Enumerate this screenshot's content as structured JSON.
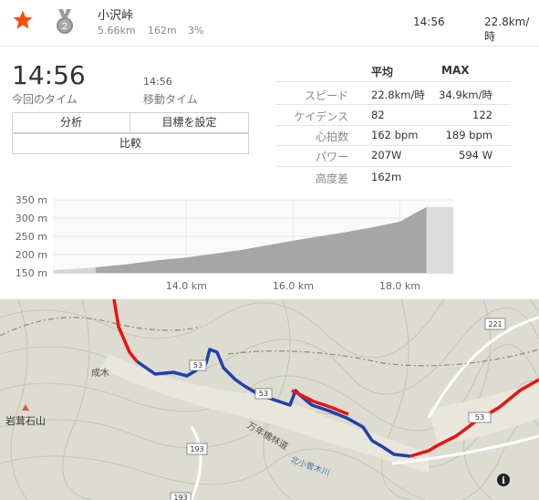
{
  "header": {
    "segment_name": "小沢峠",
    "distance": "5.66km",
    "elevation": "162m",
    "grade": "3%",
    "time": "14:56",
    "speed": "22.8km/時",
    "medal_rank": "2"
  },
  "summary": {
    "elapsed_time": "14:56",
    "elapsed_label": "今回のタイム",
    "moving_time": "14:56",
    "moving_label": "移動タイム"
  },
  "buttons": {
    "analysis": "分析",
    "set_goal": "目標を設定",
    "compare": "比較"
  },
  "stats": {
    "col_avg": "平均",
    "col_max": "MAX",
    "rows": [
      {
        "label": "スピード",
        "avg": "22.8km/時",
        "max": "34.9km/時"
      },
      {
        "label": "ケイデンス",
        "avg": "82",
        "max": "122"
      },
      {
        "label": "心拍数",
        "avg": "162 bpm",
        "max": "189 bpm"
      },
      {
        "label": "パワー",
        "avg": "207W",
        "max": "594 W"
      },
      {
        "label": "高度差",
        "avg": "162m",
        "max": ""
      }
    ]
  },
  "chart_data": {
    "type": "area",
    "y_ticks": [
      "350 m",
      "300 m",
      "250 m",
      "200 m",
      "150 m"
    ],
    "x_ticks": [
      "14.0 km",
      "16.0 km",
      "18.0 km"
    ],
    "ylim": [
      150,
      350
    ],
    "grid": true,
    "series": [
      {
        "values_km": [
          12.3,
          12.8,
          13.5,
          14.0,
          14.5,
          15.0,
          15.5,
          16.0,
          16.5,
          17.0,
          17.5,
          18.0,
          18.3,
          18.5,
          19.0
        ],
        "values_m": [
          165,
          172,
          185,
          192,
          202,
          212,
          225,
          238,
          250,
          262,
          275,
          290,
          315,
          330,
          330
        ]
      }
    ]
  },
  "map": {
    "labels": {
      "mountain": "岩茸石山",
      "road_193a": "193",
      "road_193b": "193",
      "road_221": "221",
      "road_53": "53",
      "road_53b": "53",
      "road_53c": "53",
      "river": "北小曽木川",
      "trail": "万年橋林道",
      "place": "成木"
    },
    "info_icon": "i"
  },
  "colors": {
    "accent": "#fc4c02",
    "route_red": "#ee1111",
    "route_blue": "#2040b0"
  }
}
